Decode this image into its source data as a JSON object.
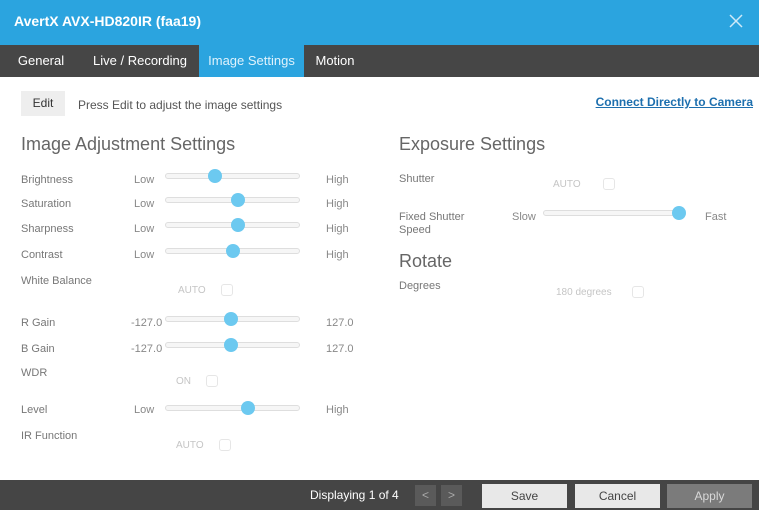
{
  "dialog": {
    "title": "AvertX AVX-HD820IR (faa19)"
  },
  "tabs": [
    {
      "label": "General"
    },
    {
      "label": "Live / Recording"
    },
    {
      "label": "Image Settings",
      "active": true
    },
    {
      "label": "Motion"
    }
  ],
  "edit": {
    "label": "Edit",
    "hint": "Press Edit to adjust the image settings"
  },
  "connect_link": "Connect Directly to Camera",
  "image_adjustment": {
    "heading": "Image Adjustment Settings",
    "brightness": {
      "label": "Brightness",
      "min": "Low",
      "max": "High",
      "value": 0.37
    },
    "saturation": {
      "label": "Saturation",
      "min": "Low",
      "max": "High",
      "value": 0.54
    },
    "sharpness": {
      "label": "Sharpness",
      "min": "Low",
      "max": "High",
      "value": 0.54
    },
    "contrast": {
      "label": "Contrast",
      "min": "Low",
      "max": "High",
      "value": 0.5
    },
    "white_balance": {
      "label": "White Balance",
      "value": "AUTO"
    },
    "r_gain": {
      "label": "R Gain",
      "min": "-127.0",
      "max": "127.0",
      "value": 0.49
    },
    "b_gain": {
      "label": "B Gain",
      "min": "-127.0",
      "max": "127.0",
      "value": 0.49
    },
    "wdr": {
      "label": "WDR",
      "value": "ON"
    },
    "level": {
      "label": "Level",
      "min": "Low",
      "max": "High",
      "value": 0.62
    },
    "ir_function": {
      "label": "IR Function",
      "value": "AUTO"
    }
  },
  "exposure": {
    "heading": "Exposure Settings",
    "shutter": {
      "label": "Shutter",
      "value": "AUTO"
    },
    "fixed_shutter": {
      "label_line1": "Fixed Shutter",
      "label_line2": "Speed",
      "min": "Slow",
      "max": "Fast",
      "value": 1.0
    }
  },
  "rotate": {
    "heading": "Rotate",
    "degrees": {
      "label": "Degrees",
      "value": "180 degrees"
    }
  },
  "footer": {
    "display": "Displaying 1 of 4",
    "prev": "<",
    "next": ">",
    "save": "Save",
    "cancel": "Cancel",
    "apply": "Apply"
  },
  "colors": {
    "accent": "#2ba4df",
    "dark_bar": "#464646",
    "thumb": "#6cc9f0",
    "link": "#1d6fae"
  }
}
